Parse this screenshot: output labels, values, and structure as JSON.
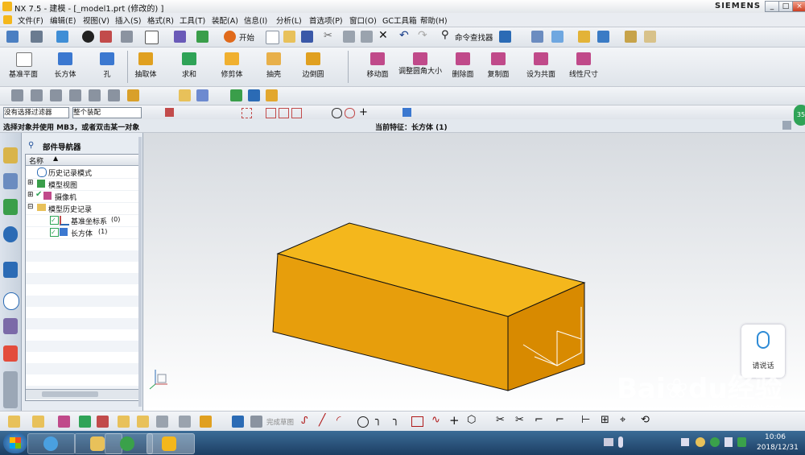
{
  "app": {
    "title": "NX 7.5 - 建模 - [_model1.prt (修改的) ]",
    "brand": "SIEMENS",
    "win_min": "_",
    "win_max": "□",
    "win_close": "×"
  },
  "menubar": [
    "文件(F)",
    "编辑(E)",
    "视图(V)",
    "插入(S)",
    "格式(R)",
    "工具(T)",
    "装配(A)",
    "信息(I)",
    "分析(L)",
    "首选项(P)",
    "窗口(O)",
    "GC工具箱",
    "帮助(H)"
  ],
  "toolbar1": {
    "start_label": "开始",
    "command_finder": "命令查找器"
  },
  "feature_toolbar": {
    "left": [
      "基准平面",
      "长方体",
      "孔",
      "抽取体",
      "求和",
      "修剪体",
      "抽壳",
      "边倒圆"
    ],
    "right": [
      "移动面",
      "调整圆角大小",
      "删除面",
      "复制面",
      "设为共面",
      "线性尺寸"
    ]
  },
  "selection": {
    "filter": "没有选择过滤器",
    "scope": "整个装配"
  },
  "status": {
    "prompt": "选择对象并使用 MB3，或者双击某一对象",
    "current_feature": "当前特征：长方体 (1)",
    "badge": "35"
  },
  "navigator": {
    "title": "部件导航器",
    "column": "名称",
    "items": [
      {
        "label": "历史记录模式",
        "count": ""
      },
      {
        "label": "模型视图",
        "count": ""
      },
      {
        "label": "摄像机",
        "count": ""
      },
      {
        "label": "模型历史记录",
        "count": ""
      },
      {
        "label": "基准坐标系",
        "count": "(0)"
      },
      {
        "label": "长方体",
        "count": "(1)"
      }
    ]
  },
  "sketch": {
    "finish_label": "完成草图"
  },
  "voice": {
    "label": "请说话"
  },
  "watermark": {
    "brand": "Bai",
    "brand2": "du",
    "brand3": "经验",
    "url": "jingyan.baidu.com"
  },
  "taskbar": {
    "time": "10:06",
    "date": "2018/12/31"
  },
  "colors": {
    "body_top": "#f4b71c",
    "body_front": "#e79e0c",
    "body_side": "#d88a00",
    "accent": "#2e8bd6"
  }
}
